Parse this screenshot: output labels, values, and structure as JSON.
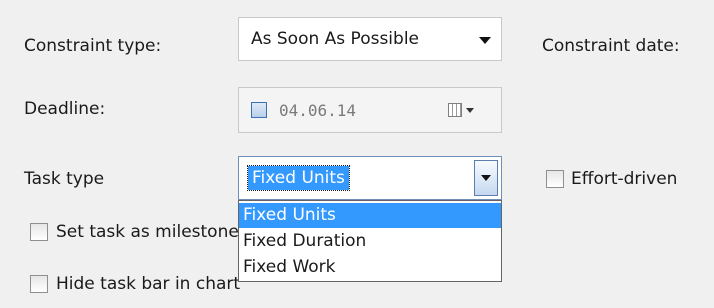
{
  "constraint": {
    "type_label": "Constraint type:",
    "type_value": "As Soon As Possible",
    "date_label": "Constraint date:"
  },
  "deadline": {
    "label": "Deadline:",
    "value": "04.06.14",
    "checked": false
  },
  "task_type": {
    "label": "Task type",
    "selected": "Fixed Units",
    "options": [
      "Fixed Units",
      "Fixed Duration",
      "Fixed Work"
    ],
    "highlighted_index": 0
  },
  "effort_driven": {
    "label": "Effort-driven",
    "checked": false
  },
  "milestone": {
    "label": "Set task as milestone",
    "checked": false
  },
  "hide_bar": {
    "label": "Hide task bar in chart",
    "checked": false
  },
  "colors": {
    "highlight": "#3399ff",
    "background": "#f0f0f0"
  }
}
